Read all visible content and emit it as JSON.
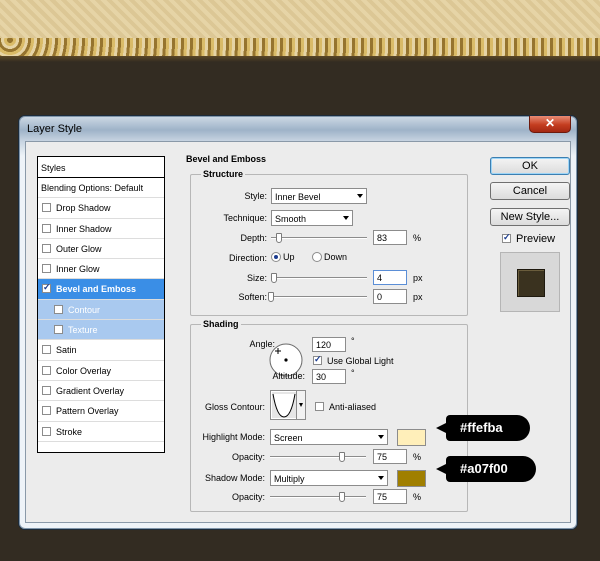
{
  "window": {
    "title": "Layer Style",
    "close_glyph": "✕"
  },
  "styles_panel": {
    "header": "Styles",
    "blending": "Blending Options: Default",
    "items": [
      {
        "label": "Drop Shadow",
        "checked": false
      },
      {
        "label": "Inner Shadow",
        "checked": false
      },
      {
        "label": "Outer Glow",
        "checked": false
      },
      {
        "label": "Inner Glow",
        "checked": false
      },
      {
        "label": "Bevel and Emboss",
        "checked": true,
        "selected": true
      },
      {
        "label": "Contour",
        "checked": false,
        "sub": true
      },
      {
        "label": "Texture",
        "checked": false,
        "sub": true
      },
      {
        "label": "Satin",
        "checked": false
      },
      {
        "label": "Color Overlay",
        "checked": false
      },
      {
        "label": "Gradient Overlay",
        "checked": false
      },
      {
        "label": "Pattern Overlay",
        "checked": false
      },
      {
        "label": "Stroke",
        "checked": false
      }
    ]
  },
  "bevel": {
    "title": "Bevel and Emboss",
    "structure": {
      "title": "Structure",
      "style_label": "Style:",
      "style_value": "Inner Bevel",
      "technique_label": "Technique:",
      "technique_value": "Smooth",
      "depth_label": "Depth:",
      "depth_value": "83",
      "depth_unit": "%",
      "depth_level": 0.08,
      "direction_label": "Direction:",
      "direction_up": "Up",
      "direction_down": "Down",
      "direction_selected": "Up",
      "size_label": "Size:",
      "size_value": "4",
      "size_unit": "px",
      "size_level": 0.03,
      "soften_label": "Soften:",
      "soften_value": "0",
      "soften_unit": "px",
      "soften_level": 0.0
    },
    "shading": {
      "title": "Shading",
      "angle_label": "Angle:",
      "angle_value": "120",
      "angle_unit": "°",
      "global_light_label": "Use Global Light",
      "global_light_checked": true,
      "altitude_label": "Altitude:",
      "altitude_value": "30",
      "altitude_unit": "°",
      "gloss_label": "Gloss Contour:",
      "anti_aliased_label": "Anti-aliased",
      "anti_aliased_checked": false,
      "highlight_mode_label": "Highlight Mode:",
      "highlight_mode_value": "Screen",
      "highlight_color": "#ffefba",
      "highlight_opacity_label": "Opacity:",
      "highlight_opacity_value": "75",
      "highlight_opacity_unit": "%",
      "highlight_opacity_level": 0.75,
      "shadow_mode_label": "Shadow Mode:",
      "shadow_mode_value": "Multiply",
      "shadow_color": "#a07f00",
      "shadow_opacity_label": "Opacity:",
      "shadow_opacity_value": "75",
      "shadow_opacity_unit": "%",
      "shadow_opacity_level": 0.75
    }
  },
  "buttons": {
    "ok": "OK",
    "cancel": "Cancel",
    "new_style": "New Style...",
    "preview_label": "Preview",
    "preview_checked": true
  },
  "annotations": {
    "highlight_tag": "#ffefba",
    "shadow_tag": "#a07f00"
  }
}
